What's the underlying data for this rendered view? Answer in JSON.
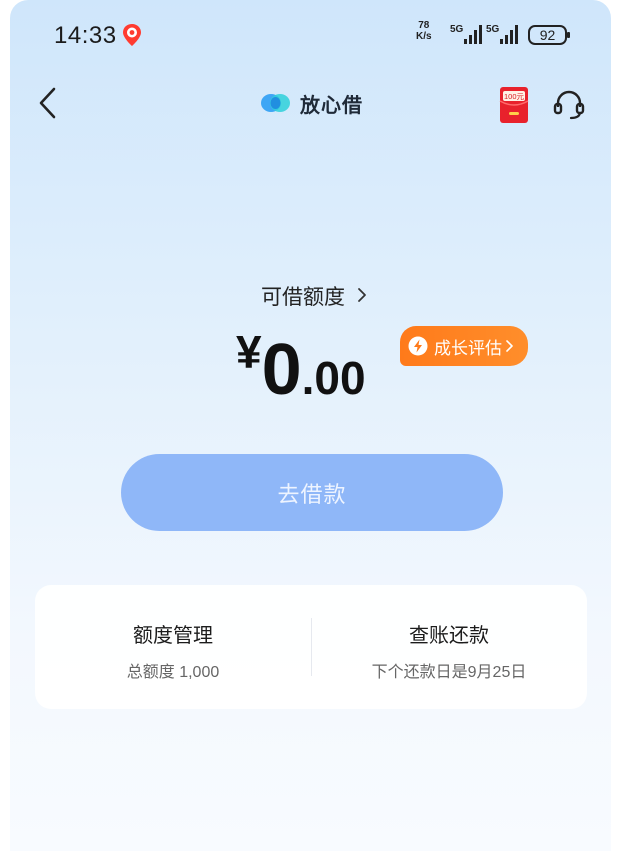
{
  "status_bar": {
    "time": "14:33",
    "net_speed_value": "78",
    "net_speed_unit": "K/s",
    "signal1": "5G",
    "signal2": "5G",
    "battery": "92"
  },
  "nav": {
    "brand_name": "放心借",
    "red_packet_label": "100元"
  },
  "credit": {
    "label": "可借额度",
    "currency": "¥",
    "amount_int": "0",
    "amount_dec": ".00",
    "growth_badge": "成长评估"
  },
  "borrow_button": "去借款",
  "card": {
    "left_title": "额度管理",
    "left_sub": "总额度 1,000",
    "right_title": "查账还款",
    "right_sub": "下个还款日是9月25日"
  },
  "colors": {
    "background_top": "#cfe6fb",
    "button": "#8fb7f8",
    "badge": "#ff7a1a"
  },
  "icons": [
    "map-pin-icon",
    "signal-icon",
    "battery-icon",
    "back-icon",
    "brand-logo-icon",
    "red-packet-icon",
    "headset-icon",
    "chevron-right-icon",
    "lightning-icon"
  ]
}
